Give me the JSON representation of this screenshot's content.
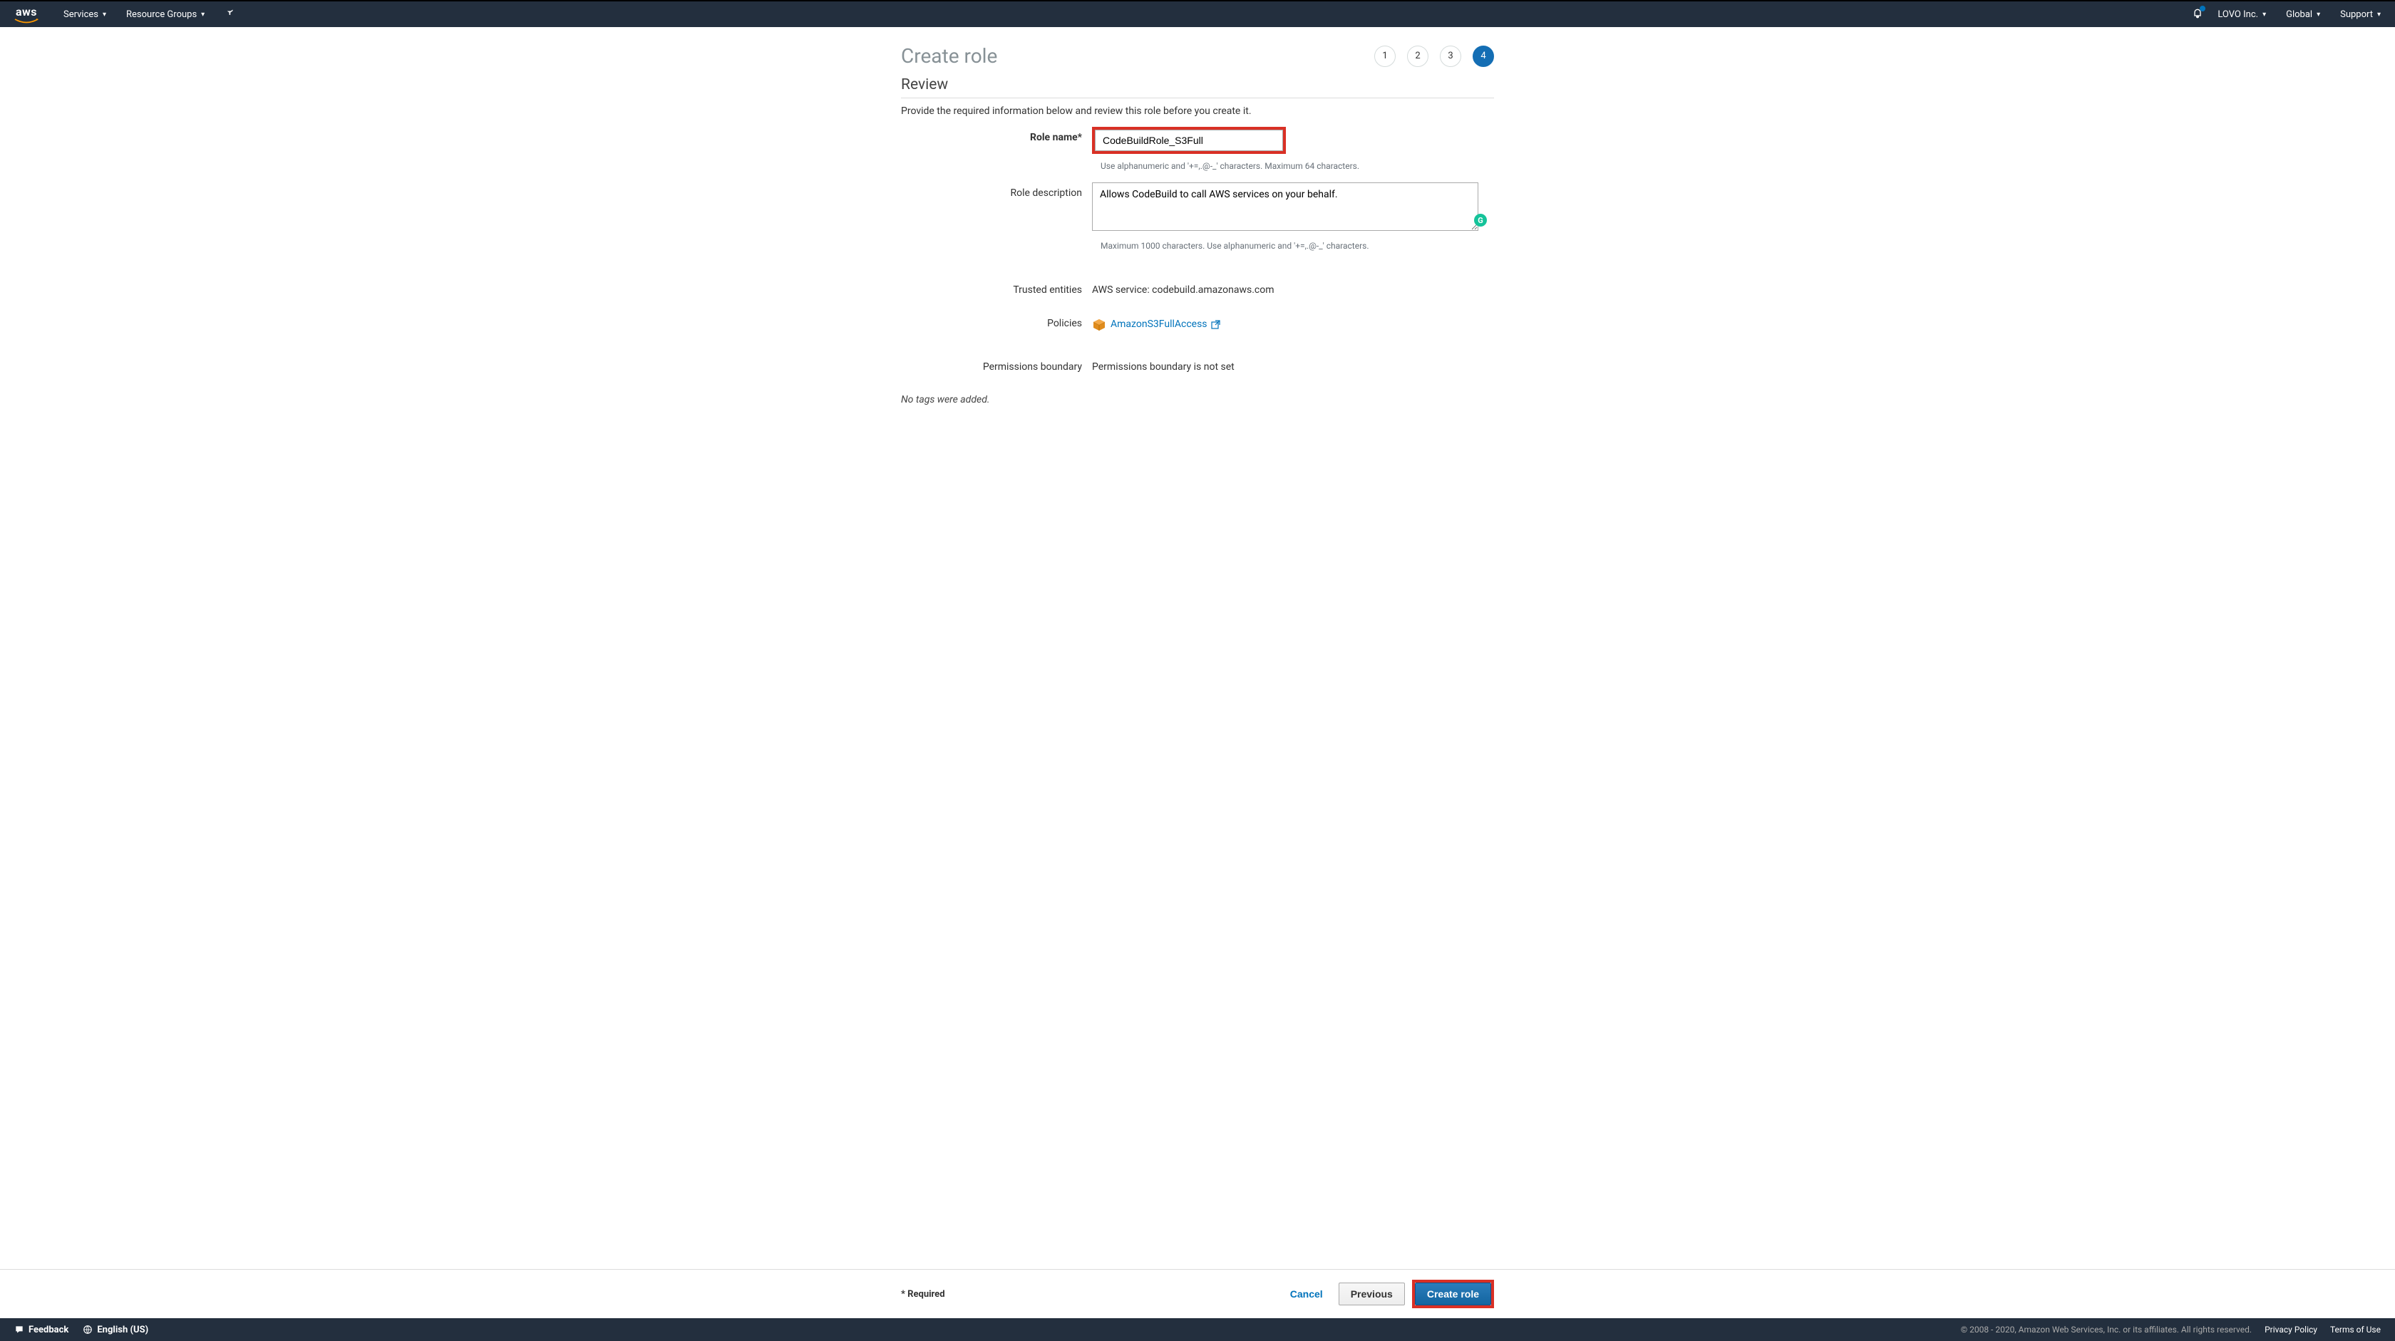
{
  "topnav": {
    "services": "Services",
    "resourceGroups": "Resource Groups",
    "account": "LOVO Inc.",
    "region": "Global",
    "support": "Support"
  },
  "page": {
    "title": "Create role",
    "steps": [
      "1",
      "2",
      "3",
      "4"
    ],
    "activeStep": 4
  },
  "section": {
    "title": "Review",
    "desc": "Provide the required information below and review this role before you create it."
  },
  "form": {
    "roleName": {
      "label": "Role name*",
      "value": "CodeBuildRole_S3Full",
      "help": "Use alphanumeric and '+=,.@-_' characters. Maximum 64 characters."
    },
    "roleDescription": {
      "label": "Role description",
      "value": "Allows CodeBuild to call AWS services on your behalf.",
      "help": "Maximum 1000 characters. Use alphanumeric and '+=,.@-_' characters."
    },
    "trustedEntities": {
      "label": "Trusted entities",
      "value": "AWS service: codebuild.amazonaws.com"
    },
    "policies": {
      "label": "Policies",
      "linkText": "AmazonS3FullAccess"
    },
    "permissionsBoundary": {
      "label": "Permissions boundary",
      "value": "Permissions boundary is not set"
    },
    "tagsNote": "No tags were added."
  },
  "actions": {
    "requiredNote": "* Required",
    "cancel": "Cancel",
    "previous": "Previous",
    "createRole": "Create role"
  },
  "footer": {
    "feedback": "Feedback",
    "language": "English (US)",
    "copyright": "© 2008 - 2020, Amazon Web Services, Inc. or its affiliates. All rights reserved.",
    "privacy": "Privacy Policy",
    "terms": "Terms of Use"
  },
  "grammarly": {
    "badge": "G"
  }
}
